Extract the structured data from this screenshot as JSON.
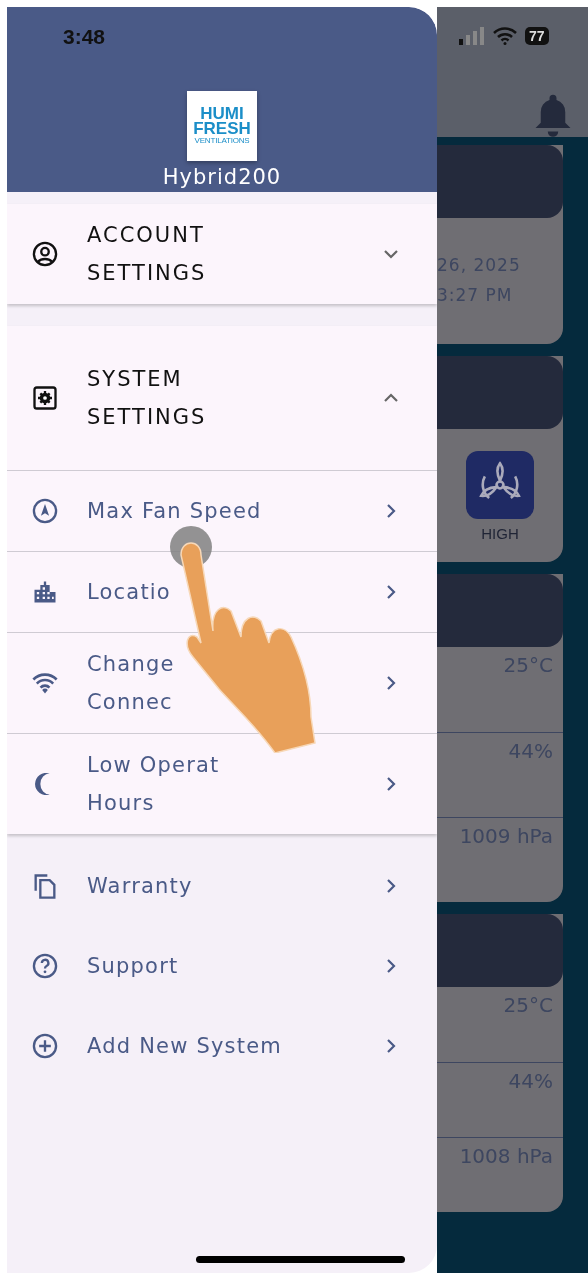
{
  "status_bar": {
    "time": "3:48",
    "battery": "77"
  },
  "drawer": {
    "logo_lines": [
      "HUMI",
      "FRESH",
      "VENTILATIONS"
    ],
    "device_name": "Hybrid200",
    "sections": [
      {
        "lines": [
          "ACCOUNT",
          "SETTINGS"
        ],
        "kind": "account",
        "expanded": false
      },
      {
        "lines": [
          "SYSTEM",
          "SETTINGS"
        ],
        "kind": "settings",
        "expanded": true,
        "items": [
          {
            "lines": [
              "Max Fan Speed"
            ],
            "kind": "navigation"
          },
          {
            "lines": [
              "Locatio"
            ],
            "kind": "city"
          },
          {
            "lines": [
              "Change",
              "Connec"
            ],
            "kind": "wifi"
          },
          {
            "lines": [
              "Low Operat",
              "Hours"
            ],
            "kind": "moon"
          }
        ]
      }
    ],
    "menu": [
      {
        "label": "Warranty",
        "kind": "copy"
      },
      {
        "label": "Support",
        "kind": "help"
      },
      {
        "label": "Add New System",
        "kind": "add"
      }
    ]
  },
  "background": {
    "cards": [
      {
        "kind": "date",
        "lines": [
          "26, 2025",
          "3:27 PM"
        ]
      },
      {
        "kind": "fan",
        "label": "HIGH"
      },
      {
        "kind": "readings",
        "rows": [
          "25°C",
          "44%",
          "1009 hPa"
        ]
      },
      {
        "kind": "readings",
        "rows": [
          "25°C",
          "44%",
          "1008 hPa"
        ]
      }
    ]
  }
}
